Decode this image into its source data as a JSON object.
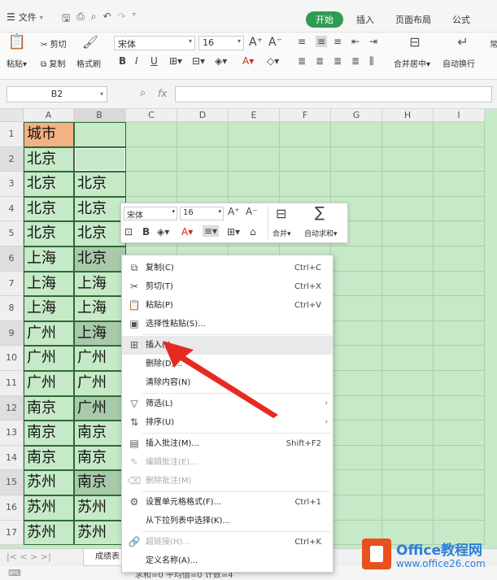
{
  "topbar": {
    "file_label": "文件",
    "tabs": [
      {
        "label": "开始",
        "active": true
      },
      {
        "label": "插入"
      },
      {
        "label": "页面布局"
      },
      {
        "label": "公式"
      }
    ]
  },
  "ribbon": {
    "paste": "粘贴",
    "cut": "剪切",
    "copy": "复制",
    "format_painter": "格式刷",
    "font_name": "宋体",
    "font_size": "16",
    "merge_center": "合并居中",
    "wrap_text": "自动换行",
    "cut_off_label": "常"
  },
  "formula_bar": {
    "name_box": "B2",
    "fx": "fx"
  },
  "columns": [
    "A",
    "B",
    "C",
    "D",
    "E",
    "F",
    "G",
    "H",
    "I"
  ],
  "rows": [
    {
      "num": "1",
      "a": "城市",
      "b": ""
    },
    {
      "num": "2",
      "a": "北京",
      "b": ""
    },
    {
      "num": "3",
      "a": "北京",
      "b": "北京"
    },
    {
      "num": "4",
      "a": "北京",
      "b": "北京"
    },
    {
      "num": "5",
      "a": "北京",
      "b": "北京"
    },
    {
      "num": "6",
      "a": "上海",
      "b": "北京"
    },
    {
      "num": "7",
      "a": "上海",
      "b": "上海"
    },
    {
      "num": "8",
      "a": "上海",
      "b": "上海"
    },
    {
      "num": "9",
      "a": "广州",
      "b": "上海"
    },
    {
      "num": "10",
      "a": "广州",
      "b": "广州"
    },
    {
      "num": "11",
      "a": "广州",
      "b": "广州"
    },
    {
      "num": "12",
      "a": "南京",
      "b": "广州"
    },
    {
      "num": "13",
      "a": "南京",
      "b": "南京"
    },
    {
      "num": "14",
      "a": "南京",
      "b": "南京"
    },
    {
      "num": "15",
      "a": "苏州",
      "b": "南京"
    },
    {
      "num": "16",
      "a": "苏州",
      "b": "苏州"
    },
    {
      "num": "17",
      "a": "苏州",
      "b": "苏州"
    }
  ],
  "mini_toolbar": {
    "font": "宋体",
    "size": "16",
    "merge": "合并",
    "autosum": "自动求和"
  },
  "context_menu": [
    {
      "label": "复制(C)",
      "key": "Ctrl+C",
      "icon": "copy-icon",
      "glyph": "⧉"
    },
    {
      "label": "剪切(T)",
      "key": "Ctrl+X",
      "icon": "scissors-icon",
      "glyph": "✂"
    },
    {
      "label": "粘贴(P)",
      "key": "Ctrl+V",
      "icon": "paste-icon",
      "glyph": "📋"
    },
    {
      "label": "选择性粘贴(S)...",
      "key": "",
      "icon": "paste-special-icon",
      "glyph": "▣"
    },
    {
      "label": "插入(I)...",
      "key": "",
      "icon": "insert-icon",
      "glyph": "⊞",
      "hover": true
    },
    {
      "label": "删除(D)...",
      "key": "",
      "icon": "",
      "glyph": ""
    },
    {
      "label": "清除内容(N)",
      "key": "",
      "icon": "",
      "glyph": ""
    },
    {
      "label": "筛选(L)",
      "key": "",
      "icon": "filter-icon",
      "glyph": "▽",
      "arrow": true
    },
    {
      "label": "排序(U)",
      "key": "",
      "icon": "sort-icon",
      "glyph": "⇅",
      "arrow": true
    },
    {
      "label": "插入批注(M)...",
      "key": "Shift+F2",
      "icon": "comment-icon",
      "glyph": "▤"
    },
    {
      "label": "编辑批注(E)...",
      "key": "",
      "icon": "edit-comment-icon",
      "glyph": "✎",
      "disabled": true
    },
    {
      "label": "删除批注(M)",
      "key": "",
      "icon": "delete-comment-icon",
      "glyph": "⌫",
      "disabled": true
    },
    {
      "label": "设置单元格格式(F)...",
      "key": "Ctrl+1",
      "icon": "format-cells-icon",
      "glyph": "⚙"
    },
    {
      "label": "从下拉列表中选择(K)...",
      "key": "",
      "icon": "",
      "glyph": ""
    },
    {
      "label": "超链接(H)...",
      "key": "Ctrl+K",
      "icon": "link-icon",
      "glyph": "🔗",
      "disabled": true
    },
    {
      "label": "定义名称(A)...",
      "key": "",
      "icon": "",
      "glyph": ""
    }
  ],
  "sheet_tab": "成绩表",
  "status": "求和=0    平均值=0    计数=4",
  "watermark": {
    "title": "Office教程网",
    "url": "www.office26.com"
  }
}
